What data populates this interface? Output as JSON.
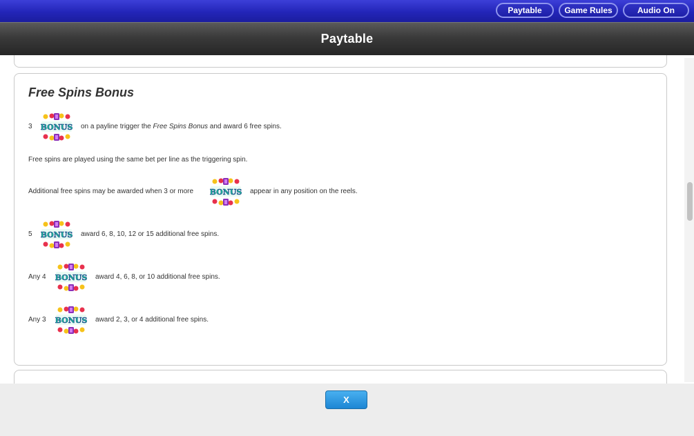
{
  "nav": {
    "paytable_label": "Paytable",
    "game_rules_label": "Game Rules",
    "audio_label": "Audio On"
  },
  "header": {
    "title": "Paytable"
  },
  "section": {
    "title": "Free Spins Bonus",
    "line1_count": "3",
    "line1_pre": "on a payline trigger the ",
    "line1_em": "Free Spins Bonus",
    "line1_post": " and award 6 free spins.",
    "line2": "Free spins are played using the same bet per line as the triggering spin.",
    "line3_pre": "Additional free spins may be awarded when 3 or more",
    "line3_post": "appear in any position on the reels.",
    "row5_count": "5",
    "row5_text": "award 6, 8, 10, 12 or 15 additional free spins.",
    "row4_count": "Any 4",
    "row4_text": "award 4, 6, 8, or 10 additional free spins.",
    "row3_count": "Any 3",
    "row3_text": "award 2, 3, or 4 additional free spins.",
    "symbol_text": "BONUS"
  },
  "close_button": {
    "label": "X"
  },
  "colors": {
    "nav_blue": "#2325b8",
    "title_dark": "#2e2e2e",
    "button_blue": "#2a90d8",
    "bonus_red": "#e8314d",
    "bonus_green": "#19c39a",
    "bonus_yellow": "#f6c21a",
    "bonus_purple": "#8a2fb8"
  }
}
